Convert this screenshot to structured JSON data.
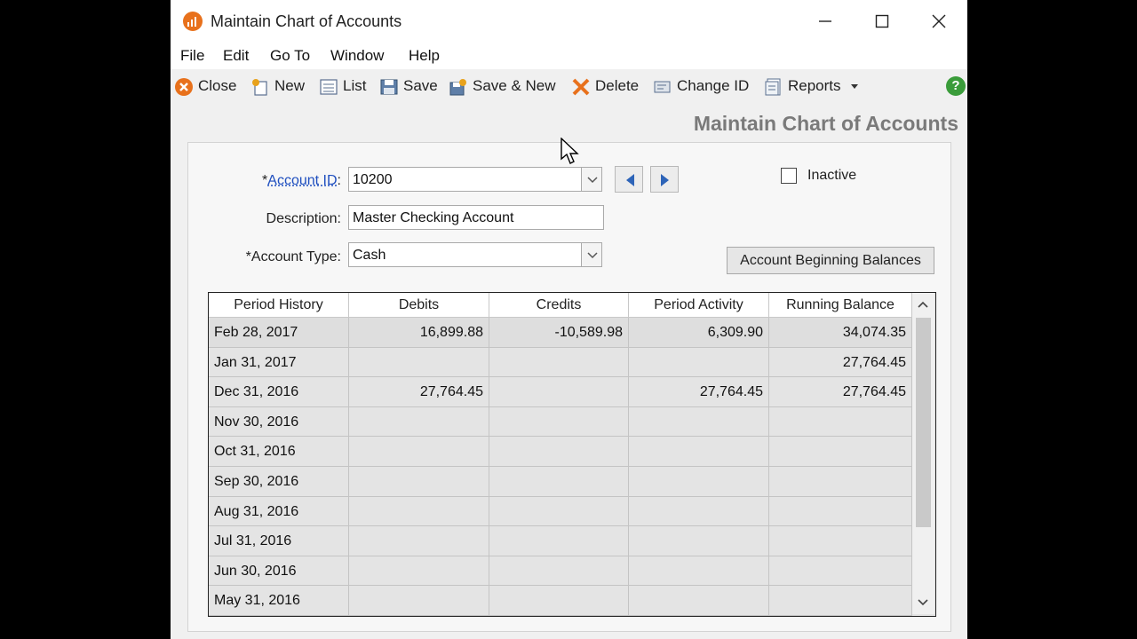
{
  "window": {
    "title": "Maintain Chart of Accounts"
  },
  "menu": [
    "File",
    "Edit",
    "Go To",
    "Window",
    "Help"
  ],
  "toolbar": {
    "close": "Close",
    "new": "New",
    "list": "List",
    "save": "Save",
    "save_new": "Save & New",
    "delete": "Delete",
    "change_id": "Change ID",
    "reports": "Reports"
  },
  "page_heading": "Maintain Chart of Accounts",
  "form": {
    "account_id_prefix": "*",
    "account_id_label": "Account ID",
    "account_id_colon": ":",
    "account_id_value": "10200",
    "description_label": "Description:",
    "description_value": "Master Checking Account",
    "account_type_label": "*Account Type:",
    "account_type_value": "Cash",
    "inactive_label": "Inactive",
    "beginning_balances": "Account Beginning Balances"
  },
  "grid": {
    "columns": [
      "Period History",
      "Debits",
      "Credits",
      "Period Activity",
      "Running Balance"
    ],
    "rows": [
      [
        "Feb 28, 2017",
        "16,899.88",
        "-10,589.98",
        "6,309.90",
        "34,074.35"
      ],
      [
        "Jan 31, 2017",
        "",
        "",
        "",
        "27,764.45"
      ],
      [
        "Dec 31, 2016",
        "27,764.45",
        "",
        "27,764.45",
        "27,764.45"
      ],
      [
        "Nov 30, 2016",
        "",
        "",
        "",
        ""
      ],
      [
        "Oct 31, 2016",
        "",
        "",
        "",
        ""
      ],
      [
        "Sep 30, 2016",
        "",
        "",
        "",
        ""
      ],
      [
        "Aug 31, 2016",
        "",
        "",
        "",
        ""
      ],
      [
        "Jul 31, 2016",
        "",
        "",
        "",
        ""
      ],
      [
        "Jun 30, 2016",
        "",
        "",
        "",
        ""
      ],
      [
        "May 31, 2016",
        "",
        "",
        "",
        ""
      ]
    ]
  },
  "colors": {
    "accent_orange": "#e8711c",
    "heading_gray": "#7a7a7a",
    "help_green": "#3a9c3a",
    "link_blue": "#1f4fbf"
  }
}
